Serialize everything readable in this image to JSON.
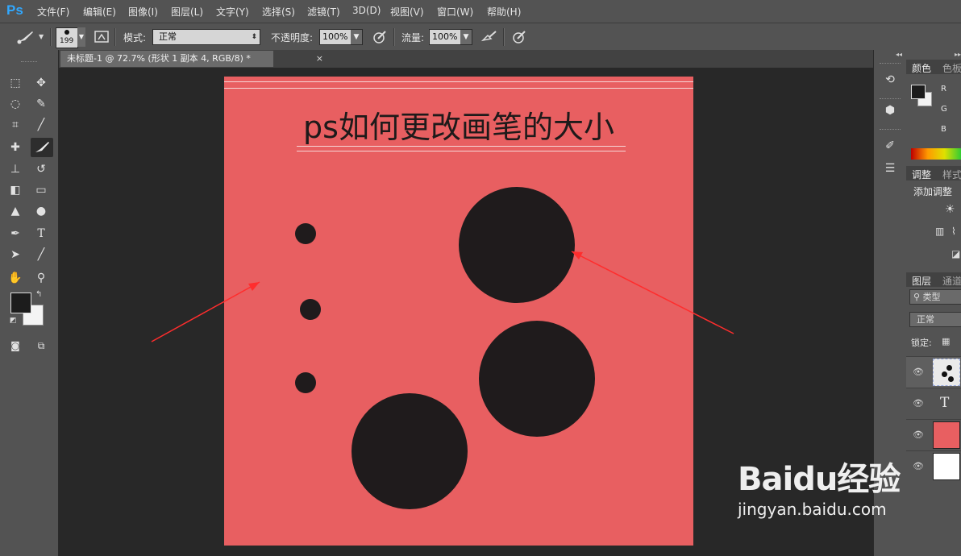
{
  "app": {
    "logo": "Ps"
  },
  "menu": [
    "文件(F)",
    "编辑(E)",
    "图像(I)",
    "图层(L)",
    "文字(Y)",
    "选择(S)",
    "滤镜(T)",
    "3D(D)",
    "视图(V)",
    "窗口(W)",
    "帮助(H)"
  ],
  "options": {
    "brush_size": "199",
    "mode_label": "模式:",
    "mode_value": "正常",
    "opacity_label": "不透明度:",
    "opacity_value": "100%",
    "flow_label": "流量:",
    "flow_value": "100%"
  },
  "document": {
    "tab_title": "未标题-1 @ 72.7% (形状 1 副本 4, RGB/8) *",
    "close": "×"
  },
  "canvas": {
    "title": "ps如何更改画笔的大小",
    "background": "#e85f61",
    "dot_color": "#1f1b1c"
  },
  "panels": {
    "color_tab": "颜色",
    "swatches_tab": "色板",
    "channels": [
      "R",
      "G",
      "B"
    ],
    "adjust_tab": "调整",
    "styles_tab": "样式",
    "add_adjust": "添加调整",
    "layers_tab": "图层",
    "paths_tab": "通道",
    "filter_kind": "类型",
    "blend_mode": "正常",
    "lock_label": "锁定:"
  },
  "watermark": {
    "brand": "Baidu经验",
    "url": "jingyan.baidu.com"
  },
  "icons": [
    "brush-icon",
    "marquee-icon",
    "move-icon",
    "lasso-icon",
    "quick-select-icon",
    "crop-icon",
    "eyedropper-icon",
    "healing-icon",
    "brush-tool-icon",
    "stamp-icon",
    "history-brush-icon",
    "eraser-icon",
    "gradient-icon",
    "blur-icon",
    "dodge-icon",
    "pen-icon",
    "type-icon",
    "path-select-icon",
    "line-icon",
    "hand-icon",
    "zoom-icon",
    "eye-icon"
  ]
}
